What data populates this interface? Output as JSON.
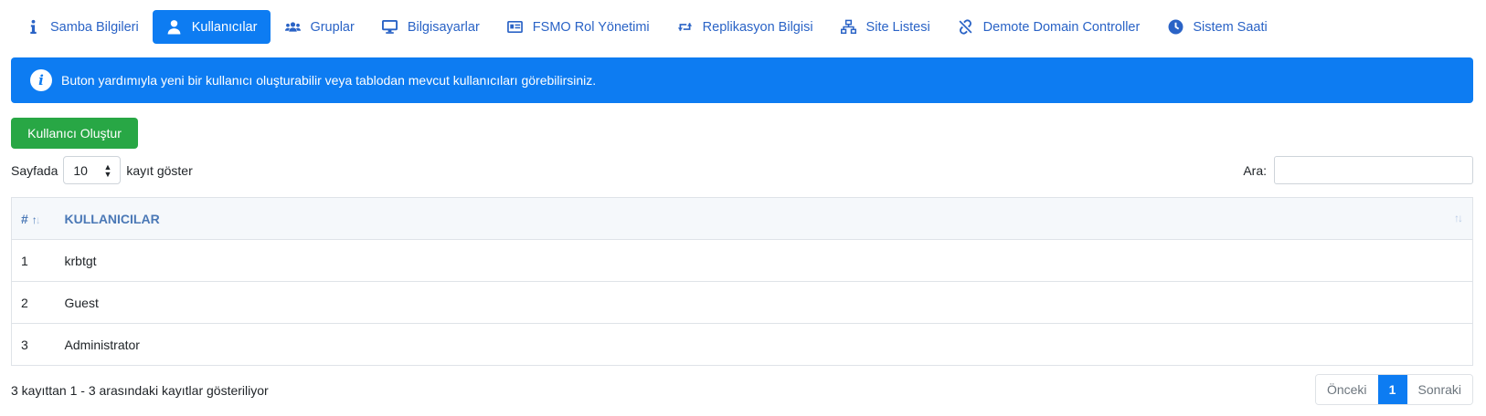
{
  "tabs": [
    {
      "label": "Samba Bilgileri",
      "icon": "info-icon",
      "active": false
    },
    {
      "label": "Kullanıcılar",
      "icon": "user-icon",
      "active": true
    },
    {
      "label": "Gruplar",
      "icon": "users-icon",
      "active": false
    },
    {
      "label": "Bilgisayarlar",
      "icon": "desktop-icon",
      "active": false
    },
    {
      "label": "FSMO Rol Yönetimi",
      "icon": "id-card-icon",
      "active": false
    },
    {
      "label": "Replikasyon Bilgisi",
      "icon": "retweet-icon",
      "active": false
    },
    {
      "label": "Site Listesi",
      "icon": "sitemap-icon",
      "active": false
    },
    {
      "label": "Demote Domain Controller",
      "icon": "unlink-icon",
      "active": false
    },
    {
      "label": "Sistem Saati",
      "icon": "clock-icon",
      "active": false
    }
  ],
  "alert": {
    "text": "Buton yardımıyla yeni bir kullanıcı oluşturabilir veya tablodan mevcut kullanıcıları görebilirsiniz.",
    "icon": "info-circle-icon"
  },
  "create_button": {
    "label": "Kullanıcı Oluştur"
  },
  "length_menu": {
    "prefix": "Sayfada",
    "value": "10",
    "suffix": "kayıt göster"
  },
  "search": {
    "label": "Ara:",
    "value": ""
  },
  "table": {
    "columns": [
      "#",
      "KULLANICILAR"
    ],
    "rows": [
      {
        "num": "1",
        "name": "krbtgt"
      },
      {
        "num": "2",
        "name": "Guest"
      },
      {
        "num": "3",
        "name": "Administrator"
      }
    ]
  },
  "footer": {
    "info": "3 kayıttan 1 - 3 arasındaki kayıtlar gösteriliyor",
    "prev": "Önceki",
    "page": "1",
    "next": "Sonraki"
  },
  "colors": {
    "primary": "#0d7cf2",
    "success": "#28a745",
    "link": "#2a63c6",
    "header_text": "#4a78b6"
  }
}
